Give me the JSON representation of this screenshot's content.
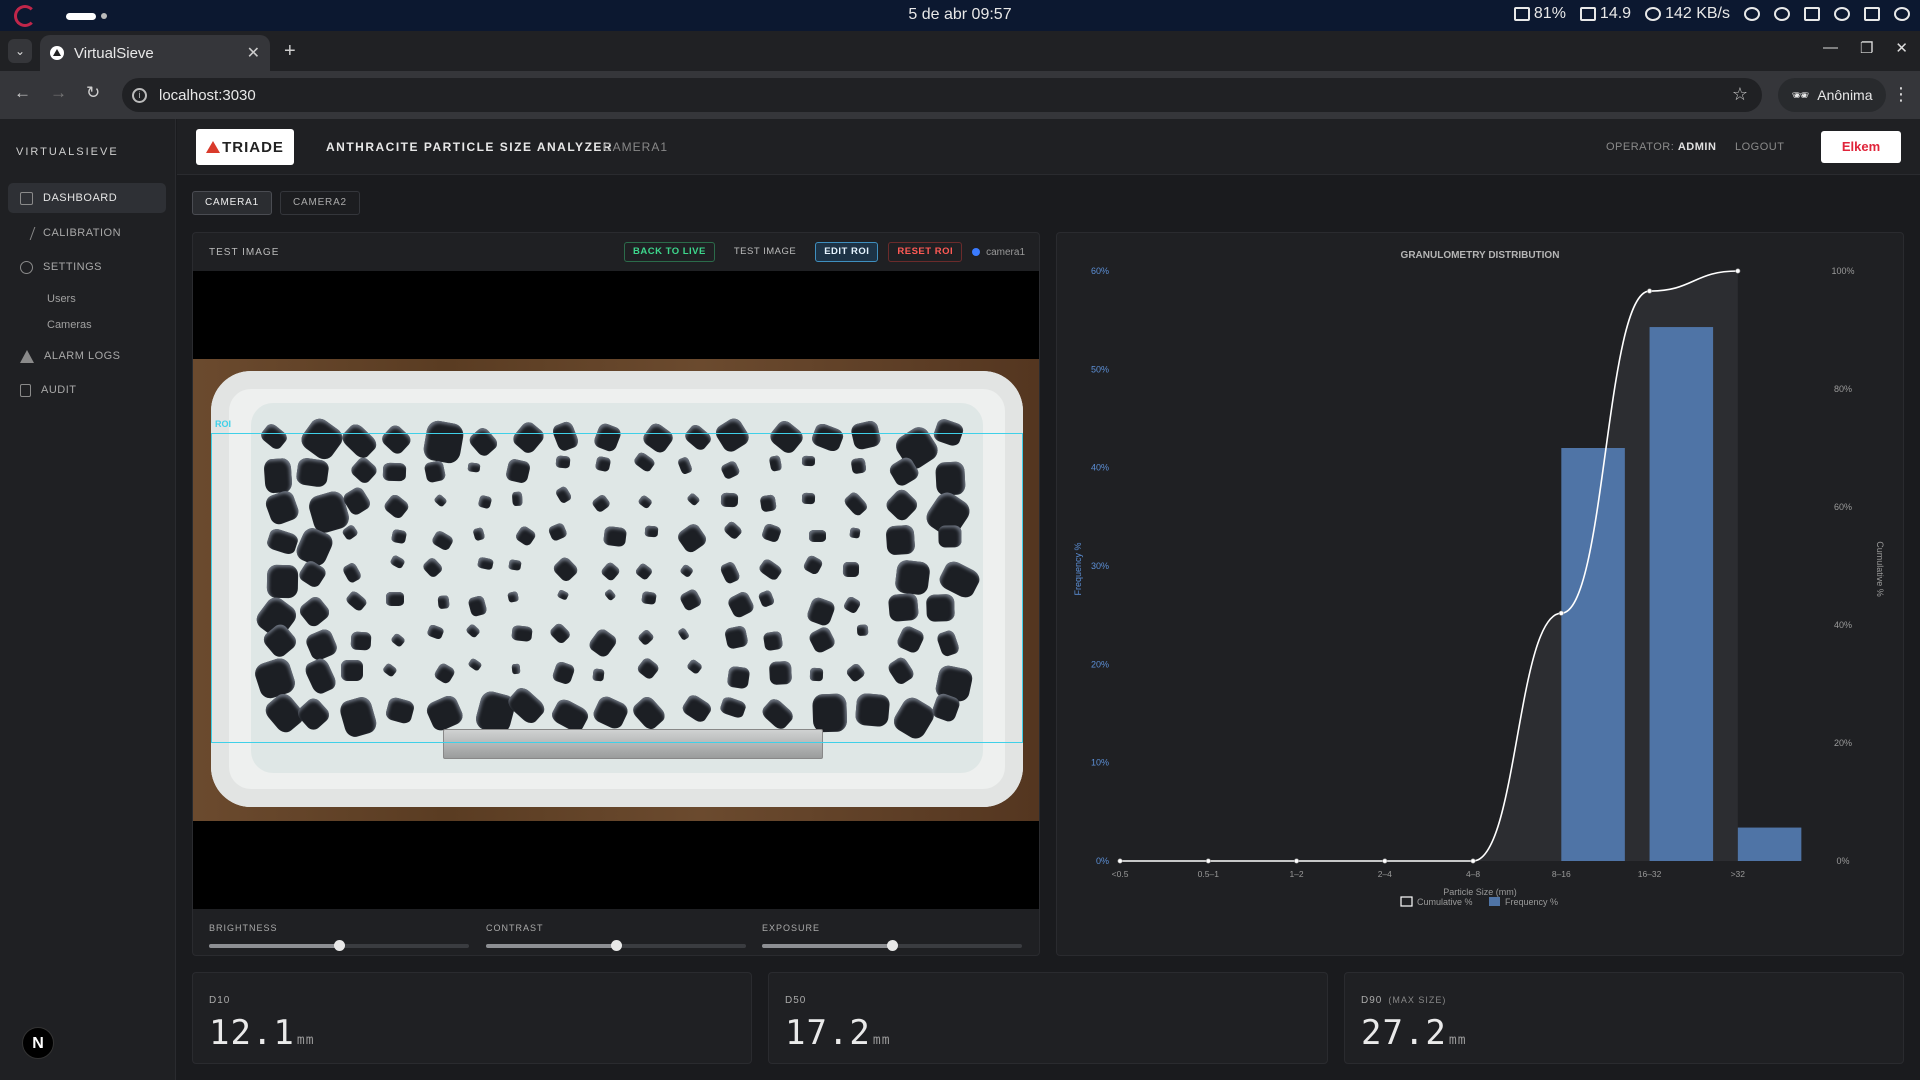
{
  "os": {
    "clock": "5 de abr  09:57",
    "battery": "81%",
    "display": "14.9",
    "network": "142 KB/s"
  },
  "browser": {
    "tab_title": "VirtualSieve",
    "url": "localhost:3030",
    "profile": "Anônima"
  },
  "sidebar": {
    "brand": "VIRTUALSIEVE",
    "items": [
      {
        "label": "DASHBOARD",
        "icon": "grid-icon"
      },
      {
        "label": "CALIBRATION",
        "icon": "bolt-icon"
      },
      {
        "label": "SETTINGS",
        "icon": "gear-icon"
      },
      {
        "label": "ALARM LOGS",
        "icon": "warning-icon"
      },
      {
        "label": "AUDIT",
        "icon": "document-icon"
      }
    ],
    "subitems": [
      "Users",
      "Cameras"
    ],
    "badge": "N"
  },
  "header": {
    "logo_text": "TRIADE",
    "title": "ANTHRACITE PARTICLE SIZE ANALYZER",
    "camera": "CAMERA1",
    "operator_label": "OPERATOR:",
    "operator_name": "ADMIN",
    "logout": "LOGOUT",
    "partner_logo": "Elkem"
  },
  "camera_tabs": [
    "CAMERA1",
    "CAMERA2"
  ],
  "image_panel": {
    "title": "TEST IMAGE",
    "back_to_live": "BACK TO LIVE",
    "test_image": "TEST IMAGE",
    "edit_roi": "EDIT ROI",
    "reset_roi": "RESET ROI",
    "camera_status": "camera1",
    "roi_label": "ROI",
    "sliders": [
      {
        "label": "BRIGHTNESS",
        "value": 0.5
      },
      {
        "label": "CONTRAST",
        "value": 0.5
      },
      {
        "label": "EXPOSURE",
        "value": 0.5
      }
    ]
  },
  "chart_data": {
    "type": "bar",
    "title": "GRANULOMETRY DISTRIBUTION",
    "xlabel": "Particle Size (mm)",
    "ylabel": "Frequency %",
    "y2label": "Cumulative %",
    "categories": [
      "<0.5",
      "0.5–1",
      "1–2",
      "2–4",
      "4–8",
      "8–16",
      "16–32",
      ">32"
    ],
    "series": [
      {
        "name": "Frequency %",
        "type": "bar",
        "values": [
          0,
          0,
          0,
          0,
          0,
          42,
          54.3,
          3.4
        ],
        "color": "#4f74a6"
      },
      {
        "name": "Cumulative %",
        "type": "line",
        "axis": "right",
        "values": [
          0,
          0,
          0,
          0,
          0,
          42,
          96.6,
          100
        ],
        "color": "#ffffff"
      }
    ],
    "ylim": [
      0,
      60
    ],
    "y2lim": [
      0,
      100
    ],
    "yticks": [
      "0%",
      "10%",
      "20%",
      "30%",
      "40%",
      "50%",
      "60%"
    ],
    "y2ticks": [
      "0%",
      "20%",
      "40%",
      "60%",
      "80%",
      "100%"
    ],
    "legend_position": "bottom"
  },
  "stats": [
    {
      "label": "D10",
      "sublabel": "",
      "value": "12.1",
      "unit": "mm"
    },
    {
      "label": "D50",
      "sublabel": "",
      "value": "17.2",
      "unit": "mm"
    },
    {
      "label": "D90",
      "sublabel": "(MAX SIZE)",
      "value": "27.2",
      "unit": "mm"
    }
  ]
}
